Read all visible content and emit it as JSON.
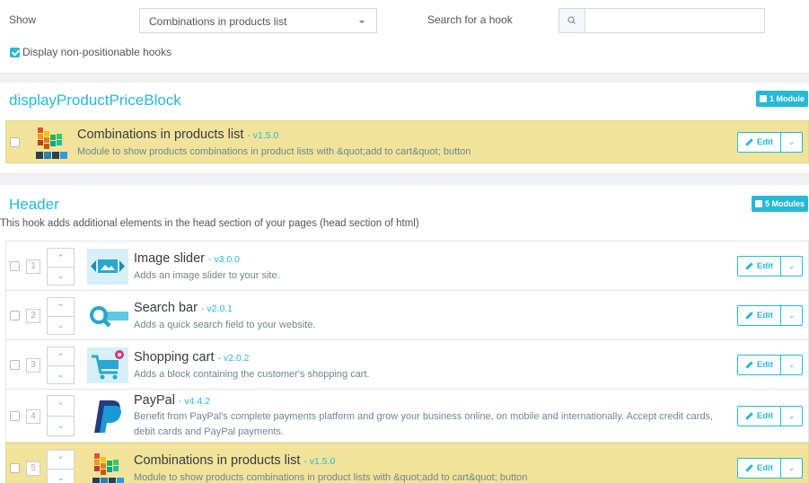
{
  "filter": {
    "show_label": "Show",
    "show_select": "Combinations in products list",
    "search_label": "Search for a hook",
    "search_value": "",
    "display_nonpositionable_label": "Display non-positionable hooks",
    "display_nonpositionable_checked": true
  },
  "hooks": [
    {
      "name": "displayProductPriceBlock",
      "badge": "1 Module",
      "description": "",
      "modules": [
        {
          "name": "Combinations in products list",
          "version": "- v1.5.0",
          "description": "Module to show products combinations in product lists with &quot;add to cart&quot; button",
          "icon": "combinations-icon",
          "highlighted": true,
          "edit_label": "Edit"
        }
      ]
    },
    {
      "name": "Header",
      "badge": "5 Modules",
      "description": "This hook adds additional elements in the head section of your pages (head section of html)",
      "modules": [
        {
          "position": "1",
          "name": "Image slider",
          "version": "- v3.0.0",
          "description": "Adds an image slider to your site.",
          "icon": "image-slider-icon",
          "highlighted": false,
          "edit_label": "Edit"
        },
        {
          "position": "2",
          "name": "Search bar",
          "version": "- v2.0.1",
          "description": "Adds a quick search field to your website.",
          "icon": "search-bar-icon",
          "highlighted": false,
          "edit_label": "Edit"
        },
        {
          "position": "3",
          "name": "Shopping cart",
          "version": "- v2.0.2",
          "description": "Adds a block containing the customer's shopping cart.",
          "icon": "shopping-cart-icon",
          "highlighted": false,
          "edit_label": "Edit"
        },
        {
          "position": "4",
          "name": "PayPal",
          "version": "- v4.4.2",
          "description": "Benefit from PayPal's complete payments platform and grow your business online, on mobile and internationally. Accept credit cards, debit cards and PayPal payments.",
          "icon": "paypal-icon",
          "highlighted": false,
          "edit_label": "Edit"
        },
        {
          "position": "5",
          "name": "Combinations in products list",
          "version": "- v1.5.0",
          "description": "Module to show products combinations in product lists with &quot;add to cart&quot; button",
          "icon": "combinations-icon",
          "highlighted": true,
          "edit_label": "Edit"
        }
      ]
    }
  ],
  "colors": {
    "accent": "#25b9d7",
    "highlight": "#f2e39b"
  }
}
